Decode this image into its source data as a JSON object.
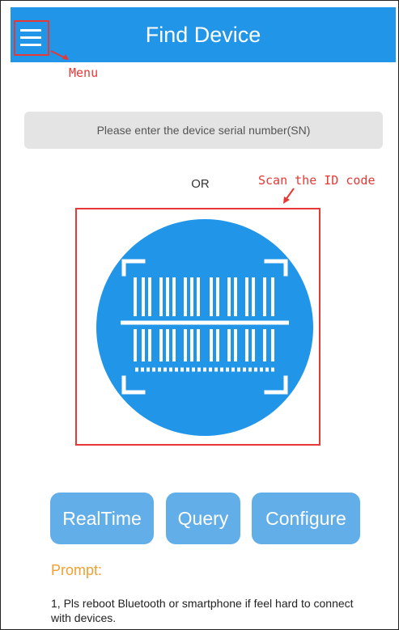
{
  "header": {
    "title": "Find Device",
    "menu_icon": "hamburger-menu-icon"
  },
  "annotations": {
    "menu": "Menu",
    "scan": "Scan the ID code"
  },
  "search": {
    "placeholder": "Please enter the device serial number(SN)"
  },
  "divider": {
    "or": "OR"
  },
  "scan": {
    "icon": "barcode-scan-icon"
  },
  "buttons": {
    "realtime": "RealTime",
    "query": "Query",
    "configure": "Configure"
  },
  "prompt": {
    "title": "Prompt:",
    "line1": "1, Pls reboot Bluetooth or smartphone if feel hard to connect with devices."
  },
  "colors": {
    "primary": "#2196E8",
    "button": "#62AEE8",
    "annotation": "#E53935",
    "prompt": "#F0A030"
  }
}
